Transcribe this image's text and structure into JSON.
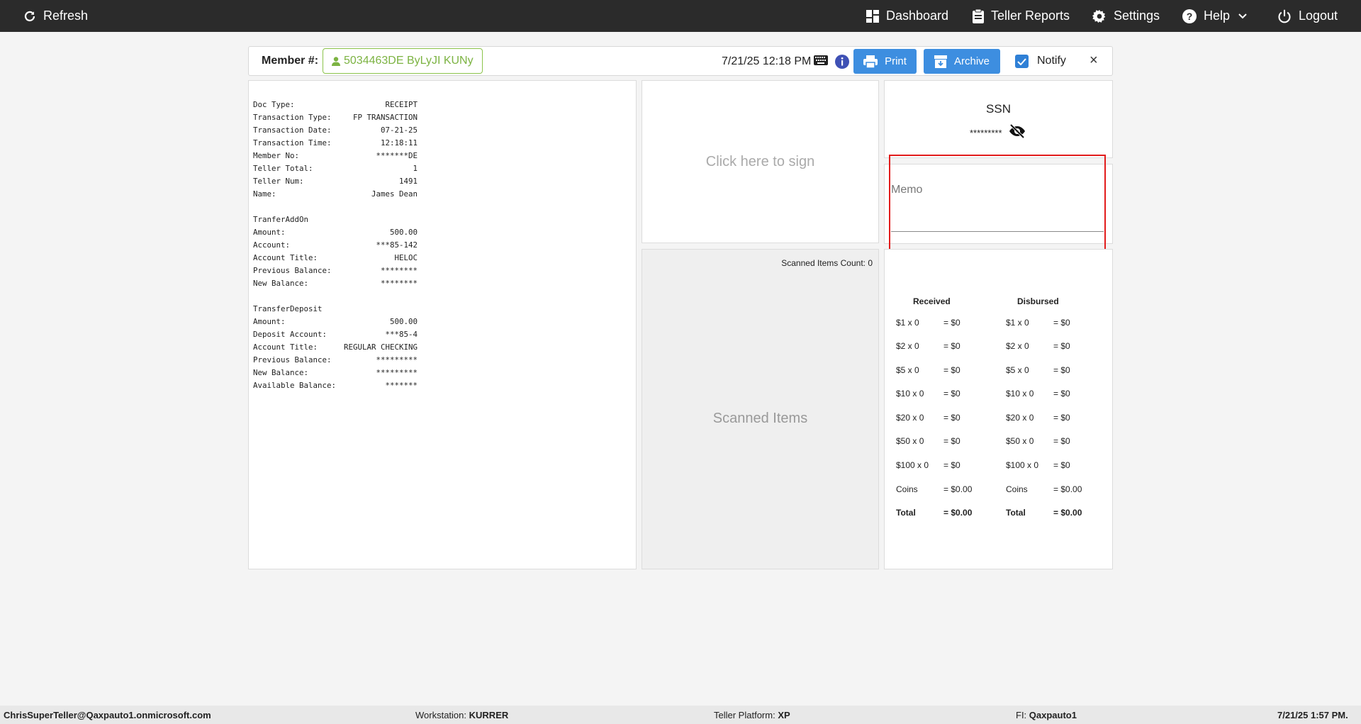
{
  "nav": {
    "refresh": "Refresh",
    "dashboard": "Dashboard",
    "teller_reports": "Teller Reports",
    "settings": "Settings",
    "help": "Help",
    "logout": "Logout"
  },
  "header": {
    "member_label": "Member #:",
    "member_value": "5034463DE ByLyJI KUNy",
    "datetime": "7/21/25 12:18 PM",
    "print": "Print",
    "archive": "Archive",
    "notify": "Notify",
    "notify_checked": true,
    "close": "×"
  },
  "receipt": {
    "rows": [
      {
        "k": "Doc Type:",
        "v": "RECEIPT"
      },
      {
        "k": "Transaction Type:",
        "v": "FP TRANSACTION"
      },
      {
        "k": "Transaction Date:",
        "v": "07-21-25"
      },
      {
        "k": "Transaction Time:",
        "v": "12:18:11"
      },
      {
        "k": "Member No:",
        "v": "*******DE"
      },
      {
        "k": "Teller Total:",
        "v": "1"
      },
      {
        "k": "Teller Num:",
        "v": "1491"
      },
      {
        "k": "Name:",
        "v": "James Dean"
      },
      {
        "k": "",
        "v": ""
      },
      {
        "k": "TranferAddOn",
        "v": ""
      },
      {
        "k": "Amount:",
        "v": "500.00"
      },
      {
        "k": "Account:",
        "v": "***85-142"
      },
      {
        "k": "Account Title:",
        "v": "HELOC"
      },
      {
        "k": "Previous Balance:",
        "v": "********"
      },
      {
        "k": "New Balance:",
        "v": "********"
      },
      {
        "k": "",
        "v": ""
      },
      {
        "k": "TransferDeposit",
        "v": ""
      },
      {
        "k": "Amount:",
        "v": "500.00"
      },
      {
        "k": "Deposit Account:",
        "v": "***85-4"
      },
      {
        "k": "Account Title:",
        "v": "REGULAR CHECKING"
      },
      {
        "k": "Previous Balance:",
        "v": "*********"
      },
      {
        "k": "New Balance:",
        "v": "*********"
      },
      {
        "k": "Available Balance:",
        "v": "*******"
      }
    ]
  },
  "sign": {
    "label": "Click here to sign"
  },
  "scanned": {
    "count_label": "Scanned Items Count: 0",
    "title": "Scanned Items"
  },
  "ssn": {
    "title": "SSN",
    "value": "*********"
  },
  "memo": {
    "label": "Memo",
    "value": ""
  },
  "cash": {
    "received_title": "Received",
    "disbursed_title": "Disbursed",
    "received": [
      {
        "label": "$1 x 0",
        "amount": "= $0"
      },
      {
        "label": "$2 x 0",
        "amount": "= $0"
      },
      {
        "label": "$5 x 0",
        "amount": "= $0"
      },
      {
        "label": "$10 x 0",
        "amount": "= $0"
      },
      {
        "label": "$20 x 0",
        "amount": "= $0"
      },
      {
        "label": "$50 x 0",
        "amount": "= $0"
      },
      {
        "label": "$100 x 0",
        "amount": "= $0"
      },
      {
        "label": "Coins",
        "amount": "= $0.00"
      },
      {
        "label": "Total",
        "amount": "= $0.00"
      }
    ],
    "disbursed": [
      {
        "label": "$1 x 0",
        "amount": "= $0"
      },
      {
        "label": "$2 x 0",
        "amount": "= $0"
      },
      {
        "label": "$5 x 0",
        "amount": "= $0"
      },
      {
        "label": "$10 x 0",
        "amount": "= $0"
      },
      {
        "label": "$20 x 0",
        "amount": "= $0"
      },
      {
        "label": "$50 x 0",
        "amount": "= $0"
      },
      {
        "label": "$100 x 0",
        "amount": "= $0"
      },
      {
        "label": "Coins",
        "amount": "= $0.00"
      },
      {
        "label": "Total",
        "amount": "= $0.00"
      }
    ]
  },
  "footer": {
    "user": "ChrisSuperTeller@Qaxpauto1.onmicrosoft.com",
    "workstation_label": "Workstation:",
    "workstation": "KURRER",
    "platform_label": "Teller Platform:",
    "platform": "XP",
    "fi_label": "FI:",
    "fi": "Qaxpauto1",
    "datetime": "7/21/25 1:57 PM."
  },
  "colors": {
    "nav_bg": "#2b2b2b",
    "button_blue": "#3d8ee0",
    "member_green": "#7cb342",
    "highlight_red": "#e21c1c"
  }
}
